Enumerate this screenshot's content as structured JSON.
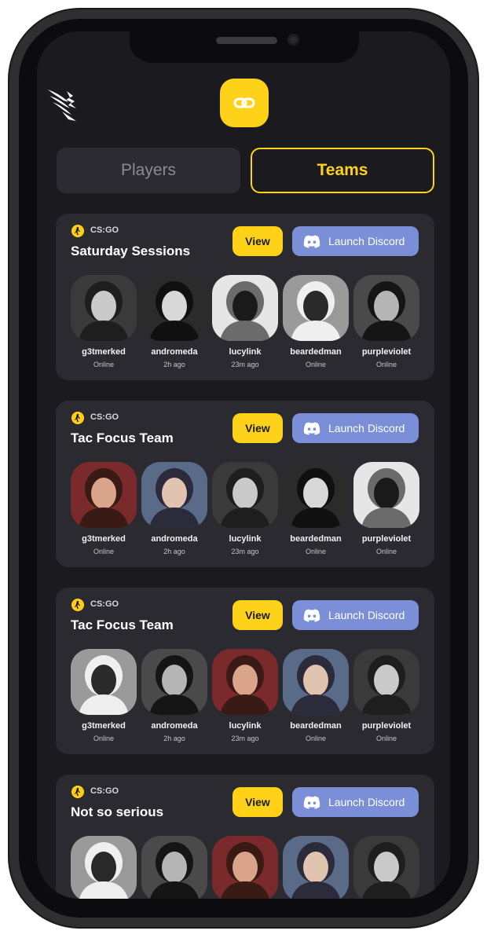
{
  "tabs": {
    "players": "Players",
    "teams": "Teams"
  },
  "colors": {
    "accent": "#ffd21a",
    "discord": "#7b8fd8",
    "card": "#2a2a30",
    "background": "#1b1b1f"
  },
  "icons": {
    "logo": "wing-logo-icon",
    "link": "link-chain-icon",
    "game": "csgo-icon",
    "discord": "discord-icon"
  },
  "teams": [
    {
      "game": "CS:GO",
      "name": "Saturday Sessions",
      "view_label": "View",
      "discord_label": "Launch Discord",
      "members": [
        {
          "name": "g3tmerked",
          "status": "Online"
        },
        {
          "name": "andromeda",
          "status": "2h ago"
        },
        {
          "name": "lucylink",
          "status": "23m ago"
        },
        {
          "name": "beardedman",
          "status": "Online"
        },
        {
          "name": "purpleviolet",
          "status": "Online"
        }
      ]
    },
    {
      "game": "CS:GO",
      "name": "Tac Focus Team",
      "view_label": "View",
      "discord_label": "Launch Discord",
      "members": [
        {
          "name": "g3tmerked",
          "status": "Online"
        },
        {
          "name": "andromeda",
          "status": "2h ago"
        },
        {
          "name": "lucylink",
          "status": "23m ago"
        },
        {
          "name": "beardedman",
          "status": "Online"
        },
        {
          "name": "purpleviolet",
          "status": "Online"
        }
      ]
    },
    {
      "game": "CS:GO",
      "name": "Tac Focus Team",
      "view_label": "View",
      "discord_label": "Launch Discord",
      "members": [
        {
          "name": "g3tmerked",
          "status": "Online"
        },
        {
          "name": "andromeda",
          "status": "2h ago"
        },
        {
          "name": "lucylink",
          "status": "23m ago"
        },
        {
          "name": "beardedman",
          "status": "Online"
        },
        {
          "name": "purpleviolet",
          "status": "Online"
        }
      ]
    },
    {
      "game": "CS:GO",
      "name": "Not so serious",
      "view_label": "View",
      "discord_label": "Launch Discord",
      "members": [
        {
          "name": "",
          "status": ""
        },
        {
          "name": "",
          "status": ""
        },
        {
          "name": "",
          "status": ""
        },
        {
          "name": "",
          "status": ""
        },
        {
          "name": "",
          "status": ""
        }
      ]
    }
  ]
}
